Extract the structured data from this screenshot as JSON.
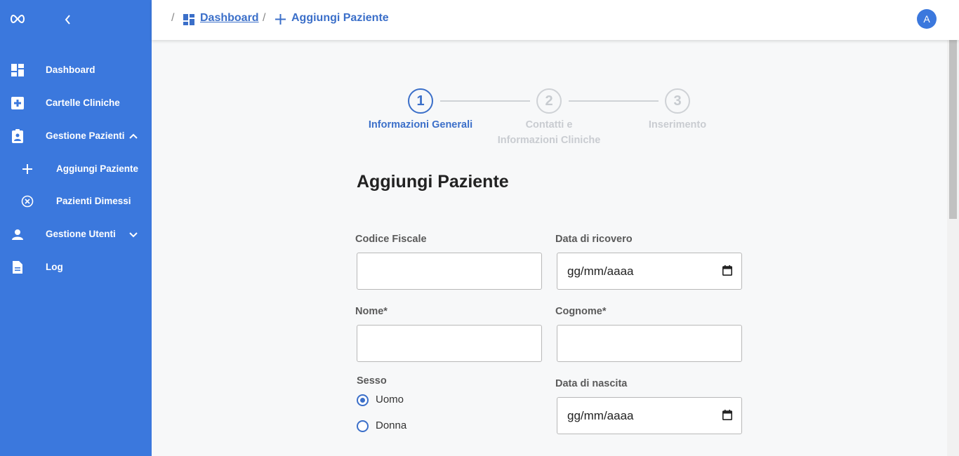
{
  "sidebar": {
    "items": [
      {
        "label": "Dashboard"
      },
      {
        "label": "Cartelle Cliniche"
      },
      {
        "label": "Gestione Pazienti"
      },
      {
        "label": "Aggiungi Paziente"
      },
      {
        "label": "Pazienti Dimessi"
      },
      {
        "label": "Gestione Utenti"
      },
      {
        "label": "Log"
      }
    ]
  },
  "breadcrumb": {
    "separator": "/",
    "dashboard": "Dashboard",
    "current": "Aggiungi Paziente"
  },
  "user": {
    "avatar_letter": "A"
  },
  "stepper": {
    "steps": [
      {
        "number": "1",
        "label": "Informazioni Generali",
        "active": true
      },
      {
        "number": "2",
        "label_line1": "Contatti e",
        "label_line2": "Informazioni Cliniche",
        "active": false
      },
      {
        "number": "3",
        "label": "Inserimento",
        "active": false
      }
    ]
  },
  "form": {
    "title": "Aggiungi Paziente",
    "codice_fiscale": {
      "label": "Codice Fiscale",
      "value": ""
    },
    "data_ricovero": {
      "label": "Data di ricovero",
      "placeholder": "gg/mm/aaaa"
    },
    "nome": {
      "label": "Nome",
      "required_mark": "*",
      "value": ""
    },
    "cognome": {
      "label": "Cognome",
      "required_mark": "*",
      "value": ""
    },
    "sesso": {
      "label": "Sesso",
      "options": [
        "Uomo",
        "Donna"
      ],
      "selected": "Uomo"
    },
    "data_nascita": {
      "label": "Data di nascita",
      "placeholder": "gg/mm/aaaa"
    }
  },
  "colors": {
    "sidebar_bg": "#3b78dd",
    "accent": "#3b6fc9",
    "inactive_step": "#c9ccd1"
  }
}
